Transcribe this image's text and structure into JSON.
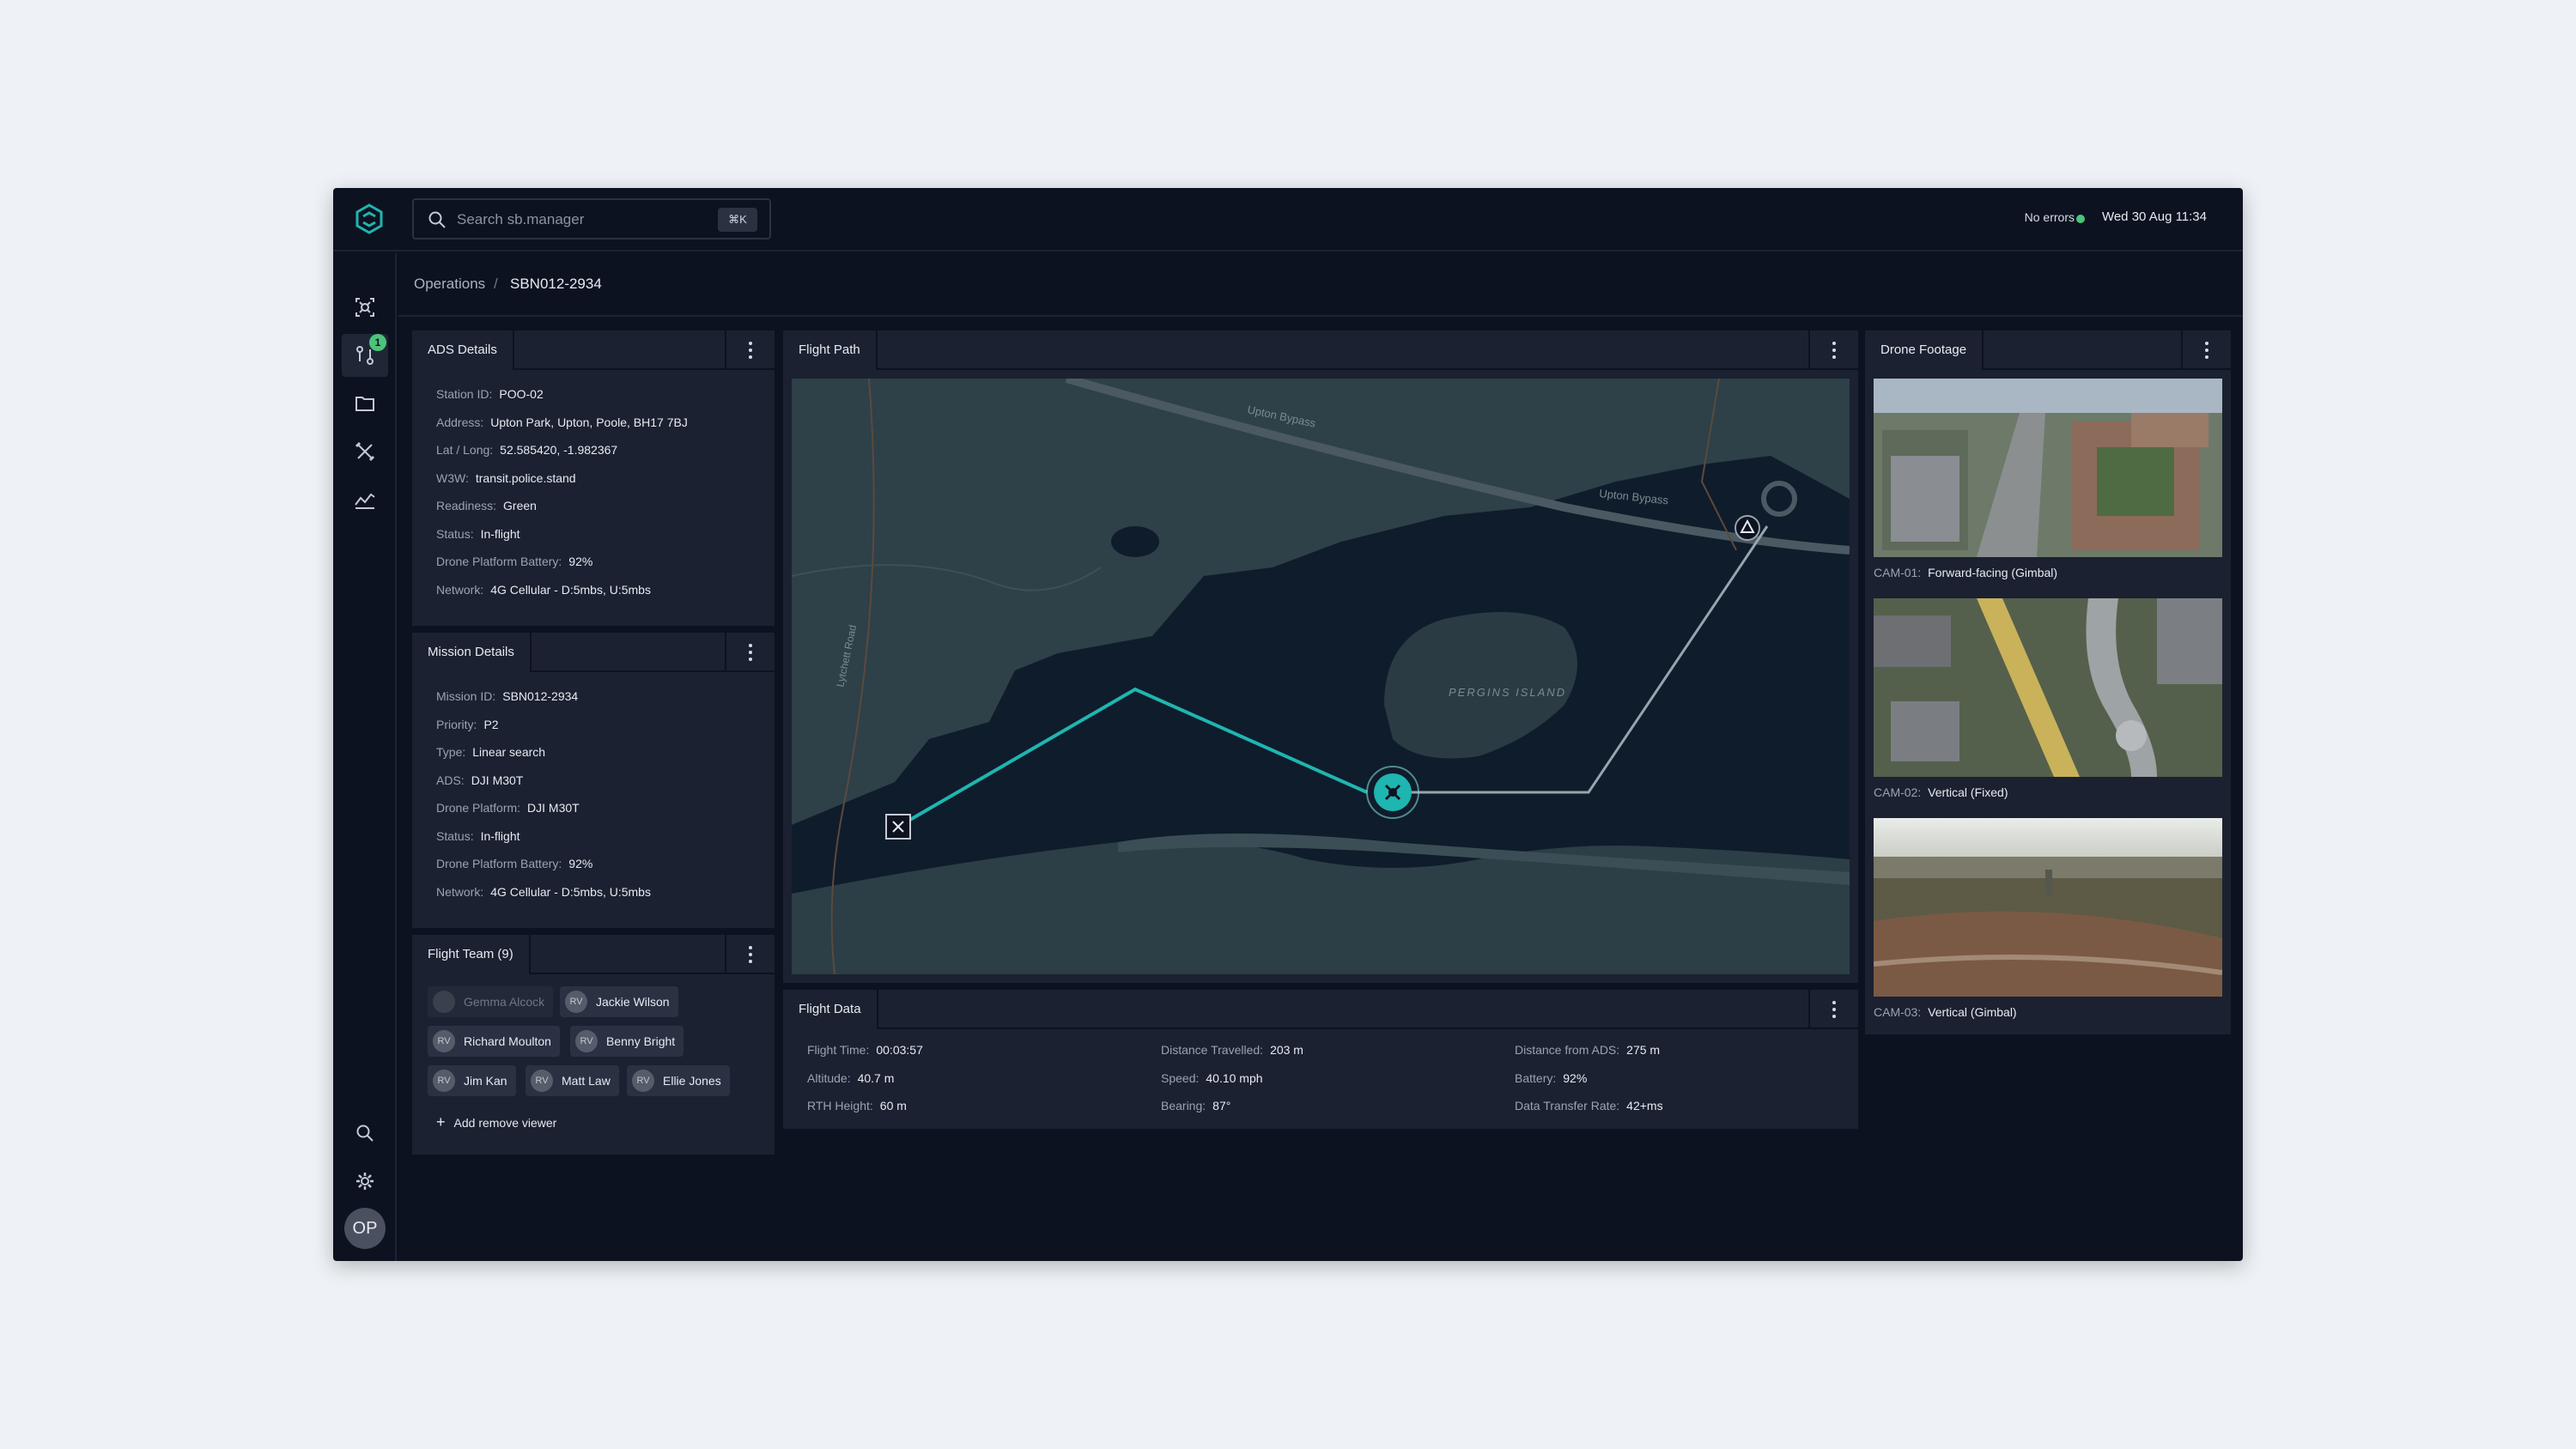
{
  "search": {
    "placeholder": "Search sb.manager",
    "shortcut": "⌘K"
  },
  "status": {
    "text": "No errors",
    "color": "#4cc37a"
  },
  "datetime": "Wed 30 Aug 11:34",
  "sidebar": {
    "badge": "1",
    "avatar": "OP"
  },
  "breadcrumb": {
    "parent": "Operations",
    "separator": "/",
    "current": "SBN012-2934"
  },
  "ads": {
    "title": "ADS Details",
    "rows": [
      {
        "k": "Station ID:",
        "v": "POO-02"
      },
      {
        "k": "Address:",
        "v": "Upton Park, Upton, Poole, BH17 7BJ"
      },
      {
        "k": "Lat / Long:",
        "v": "52.585420, -1.982367"
      },
      {
        "k": "W3W:",
        "v": "transit.police.stand"
      },
      {
        "k": "Readiness:",
        "v": "Green"
      },
      {
        "k": "Status:",
        "v": "In-flight"
      },
      {
        "k": "Drone Platform Battery:",
        "v": "92%"
      },
      {
        "k": "Network:",
        "v": "4G Cellular - D:5mbs, U:5mbs"
      }
    ]
  },
  "mission": {
    "title": "Mission Details",
    "rows": [
      {
        "k": "Mission ID:",
        "v": "SBN012-2934"
      },
      {
        "k": "Priority:",
        "v": "P2"
      },
      {
        "k": "Type:",
        "v": "Linear search"
      },
      {
        "k": "ADS:",
        "v": "DJI M30T"
      },
      {
        "k": "Drone Platform:",
        "v": "DJI M30T"
      },
      {
        "k": "Status:",
        "v": "In-flight"
      },
      {
        "k": "Drone Platform Battery:",
        "v": "92%"
      },
      {
        "k": "Network:",
        "v": "4G Cellular - D:5mbs, U:5mbs"
      }
    ]
  },
  "team": {
    "title": "Flight Team (9)",
    "members": [
      {
        "initials": "",
        "name": "Gemma Alcock",
        "dim": true
      },
      {
        "initials": "RV",
        "name": "Jackie Wilson"
      },
      {
        "initials": "RV",
        "name": "Richard Moulton"
      },
      {
        "initials": "RV",
        "name": "Benny Bright"
      },
      {
        "initials": "RV",
        "name": "Jim Kan"
      },
      {
        "initials": "RV",
        "name": "Matt Law"
      },
      {
        "initials": "RV",
        "name": "Ellie Jones"
      }
    ],
    "add_label": "Add remove viewer"
  },
  "flight_path": {
    "title": "Flight Path",
    "labels": {
      "road1": "Upton Bypass",
      "road2": "Upton Bypass",
      "road3": "Lytchett Road",
      "island": "PERGINS ISLAND"
    }
  },
  "flight_data": {
    "title": "Flight Data",
    "rows": [
      {
        "k": "Flight Time:",
        "v": "00:03:57"
      },
      {
        "k": "Altitude:",
        "v": "40.7 m"
      },
      {
        "k": "RTH Height:",
        "v": "60 m"
      },
      {
        "k": "Distance Travelled:",
        "v": "203 m"
      },
      {
        "k": "Speed:",
        "v": "40.10 mph"
      },
      {
        "k": "Bearing:",
        "v": "87°"
      },
      {
        "k": "Distance from ADS:",
        "v": "275 m"
      },
      {
        "k": "Battery:",
        "v": "92%"
      },
      {
        "k": "Data Transfer Rate:",
        "v": "42+ms"
      }
    ]
  },
  "footage": {
    "title": "Drone Footage",
    "cams": [
      {
        "id": "CAM-01:",
        "desc": "Forward-facing (Gimbal)"
      },
      {
        "id": "CAM-02:",
        "desc": "Vertical (Fixed)"
      },
      {
        "id": "CAM-03:",
        "desc": "Vertical (Gimbal)"
      }
    ]
  },
  "colors": {
    "accent": "#1fb5b0",
    "bg": "#0d1220",
    "panel": "#1b2130"
  }
}
